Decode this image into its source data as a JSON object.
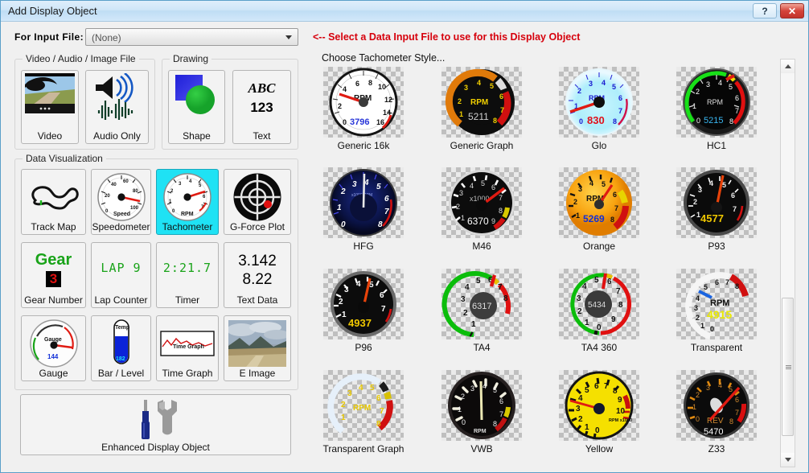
{
  "window": {
    "title": "Add Display Object",
    "help_button": "?",
    "close_button": "✕"
  },
  "toolbar": {
    "input_file_label": "For Input File:",
    "input_file_value": "(None)",
    "input_file_placeholder": "(None)",
    "hint_text": "<-- Select a Data Input File to use for this Display Object",
    "hint_color": "#d6000c"
  },
  "groups": [
    {
      "id": "video-audio-image",
      "title": "Video / Audio / Image File"
    },
    {
      "id": "drawing",
      "title": "Drawing"
    },
    {
      "id": "data-visualization",
      "title": "Data Visualization"
    }
  ],
  "tiles": {
    "video_audio_image": [
      {
        "id": "video",
        "label": "Video",
        "icon": "video-thumbnail-icon",
        "selected": false
      },
      {
        "id": "audio-only",
        "label": "Audio Only",
        "icon": "speaker-waveform-icon",
        "selected": false
      }
    ],
    "drawing": [
      {
        "id": "shape",
        "label": "Shape",
        "icon": "square-circle-icon",
        "selected": false
      },
      {
        "id": "text",
        "label": "Text",
        "icon": "abc-123-icon",
        "selected": false,
        "glyph_line1": "ABC",
        "glyph_line2": "123"
      }
    ],
    "data_visualization": [
      {
        "id": "track-map",
        "label": "Track Map",
        "icon": "track-map-icon",
        "selected": false
      },
      {
        "id": "speedometer",
        "label": "Speedometer",
        "icon": "speedometer-icon",
        "selected": false,
        "dial_caption": "Speed",
        "dial_ticks": [
          "0",
          "20",
          "40",
          "60",
          "80",
          "100"
        ]
      },
      {
        "id": "tachometer",
        "label": "Tachometer",
        "icon": "tachometer-icon",
        "selected": true,
        "dial_caption": "RPM",
        "dial_ticks": [
          "0",
          "1",
          "2",
          "3",
          "4",
          "5",
          "6",
          "7"
        ]
      },
      {
        "id": "g-force-plot",
        "label": "G-Force Plot",
        "icon": "g-force-plot-icon",
        "selected": false
      },
      {
        "id": "gear-number",
        "label": "Gear Number",
        "icon": "gear-number-icon",
        "selected": false,
        "glyph_line1": "Gear",
        "glyph_line2": "3"
      },
      {
        "id": "lap-counter",
        "label": "Lap Counter",
        "icon": "lap-counter-icon",
        "selected": false,
        "glyph_line1": "LAP 9"
      },
      {
        "id": "timer",
        "label": "Timer",
        "icon": "timer-icon",
        "selected": false,
        "glyph_line1": "2:21.7"
      },
      {
        "id": "text-data",
        "label": "Text Data",
        "icon": "text-data-icon",
        "selected": false,
        "glyph_line1": "3.142",
        "glyph_line2": "8.22"
      },
      {
        "id": "gauge",
        "label": "Gauge",
        "icon": "gauge-icon",
        "selected": false,
        "dial_caption": "Gauge",
        "dial_value": "144"
      },
      {
        "id": "bar-level",
        "label": "Bar / Level",
        "icon": "thermometer-icon",
        "selected": false,
        "glyph_line1": "Temp",
        "glyph_line2": "182"
      },
      {
        "id": "time-graph",
        "label": "Time Graph",
        "icon": "time-graph-icon",
        "selected": false,
        "glyph_line1": "Time Graph"
      },
      {
        "id": "e-image",
        "label": "E Image",
        "icon": "landscape-photo-icon",
        "selected": false
      }
    ],
    "enhanced": [
      {
        "id": "enhanced-display-object",
        "label": "Enhanced Display Object",
        "icon": "screwdriver-wrench-icon",
        "selected": false
      }
    ]
  },
  "gallery": {
    "title": "Choose Tachometer Style...",
    "items": [
      {
        "id": "generic-16k",
        "label": "Generic 16k",
        "style": "generic16k",
        "value": "3796",
        "caption": "RPM",
        "ticks": [
          "0",
          "2",
          "4",
          "6",
          "8",
          "10",
          "12",
          "14",
          "16"
        ]
      },
      {
        "id": "generic-graph",
        "label": "Generic Graph",
        "style": "genericgraph",
        "value": "5211",
        "caption": "RPM",
        "ticks": [
          "0",
          "1",
          "2",
          "3",
          "4",
          "5",
          "6",
          "7",
          "8"
        ]
      },
      {
        "id": "glo",
        "label": "Glo",
        "style": "glo",
        "value": "830",
        "caption": "RPM",
        "ticks": [
          "0",
          "1",
          "2",
          "3",
          "4",
          "5",
          "6",
          "7",
          "8"
        ]
      },
      {
        "id": "hc1",
        "label": "HC1",
        "style": "hc1",
        "value": "5215",
        "caption": "RPM",
        "ticks": [
          "0",
          "1",
          "2",
          "3",
          "4",
          "5",
          "6",
          "7",
          "8"
        ]
      },
      {
        "id": "hfg",
        "label": "HFG",
        "style": "hfg",
        "value": "",
        "caption": "x1000 RPM",
        "ticks": [
          "0",
          "1",
          "2",
          "3",
          "4",
          "5",
          "6",
          "7",
          "8"
        ]
      },
      {
        "id": "m46",
        "label": "M46",
        "style": "m46",
        "value": "6370",
        "caption": "x1000",
        "ticks": [
          "1",
          "2",
          "3",
          "4",
          "5",
          "6",
          "7",
          "8",
          "9"
        ]
      },
      {
        "id": "orange",
        "label": "Orange",
        "style": "orange",
        "value": "5269",
        "caption": "RPM",
        "ticks": [
          "1",
          "2",
          "3",
          "4",
          "5",
          "6",
          "7",
          "8"
        ]
      },
      {
        "id": "p93",
        "label": "P93",
        "style": "p93",
        "value": "4577",
        "caption": "",
        "ticks": [
          "1",
          "2",
          "3",
          "4",
          "5",
          "6",
          "7"
        ]
      },
      {
        "id": "p96",
        "label": "P96",
        "style": "p96",
        "value": "4937",
        "caption": "",
        "ticks": [
          "1",
          "2",
          "3",
          "4",
          "5",
          "6",
          "7"
        ]
      },
      {
        "id": "ta4",
        "label": "TA4",
        "style": "ta4",
        "value": "6317",
        "caption": "",
        "ticks": [
          "1",
          "2",
          "3",
          "4",
          "5",
          "6",
          "7",
          "8"
        ]
      },
      {
        "id": "ta4-360",
        "label": "TA4 360",
        "style": "ta4360",
        "value": "5434",
        "caption": "",
        "ticks": [
          "0",
          "1",
          "2",
          "3",
          "4",
          "5",
          "6",
          "7",
          "8",
          "9"
        ]
      },
      {
        "id": "transparent",
        "label": "Transparent",
        "style": "transparent",
        "value": "4915",
        "caption": "RPM",
        "ticks": [
          "0",
          "1",
          "2",
          "3",
          "4",
          "5",
          "6",
          "7",
          "8"
        ]
      },
      {
        "id": "transparent-graph",
        "label": "Transparent Graph",
        "style": "transgraph",
        "value": "",
        "caption": "RPM",
        "ticks": [
          "1",
          "2",
          "3",
          "4",
          "5",
          "6",
          "7",
          "8"
        ]
      },
      {
        "id": "vwb",
        "label": "VWB",
        "style": "vwb",
        "value": "",
        "caption": "RPM",
        "ticks": [
          "0",
          "1",
          "2",
          "3",
          "4",
          "5",
          "6",
          "7",
          "8"
        ]
      },
      {
        "id": "yellow",
        "label": "Yellow",
        "style": "yellow",
        "value": "",
        "caption": "RPM x1000",
        "ticks": [
          "0",
          "1",
          "2",
          "3",
          "4",
          "5",
          "6",
          "7",
          "8",
          "9",
          "10"
        ]
      },
      {
        "id": "z33",
        "label": "Z33",
        "style": "z33",
        "value": "5470",
        "caption": "REV",
        "ticks": [
          "0",
          "1",
          "2",
          "3",
          "4",
          "5",
          "6",
          "7",
          "8"
        ]
      }
    ]
  },
  "scrollbar": {
    "up_arrow": "▲",
    "down_arrow": "▼"
  },
  "colors": {
    "accent_selected": "#1fe2f4",
    "warning_red": "#d6000c",
    "titlebar": "#cfe6f8"
  }
}
